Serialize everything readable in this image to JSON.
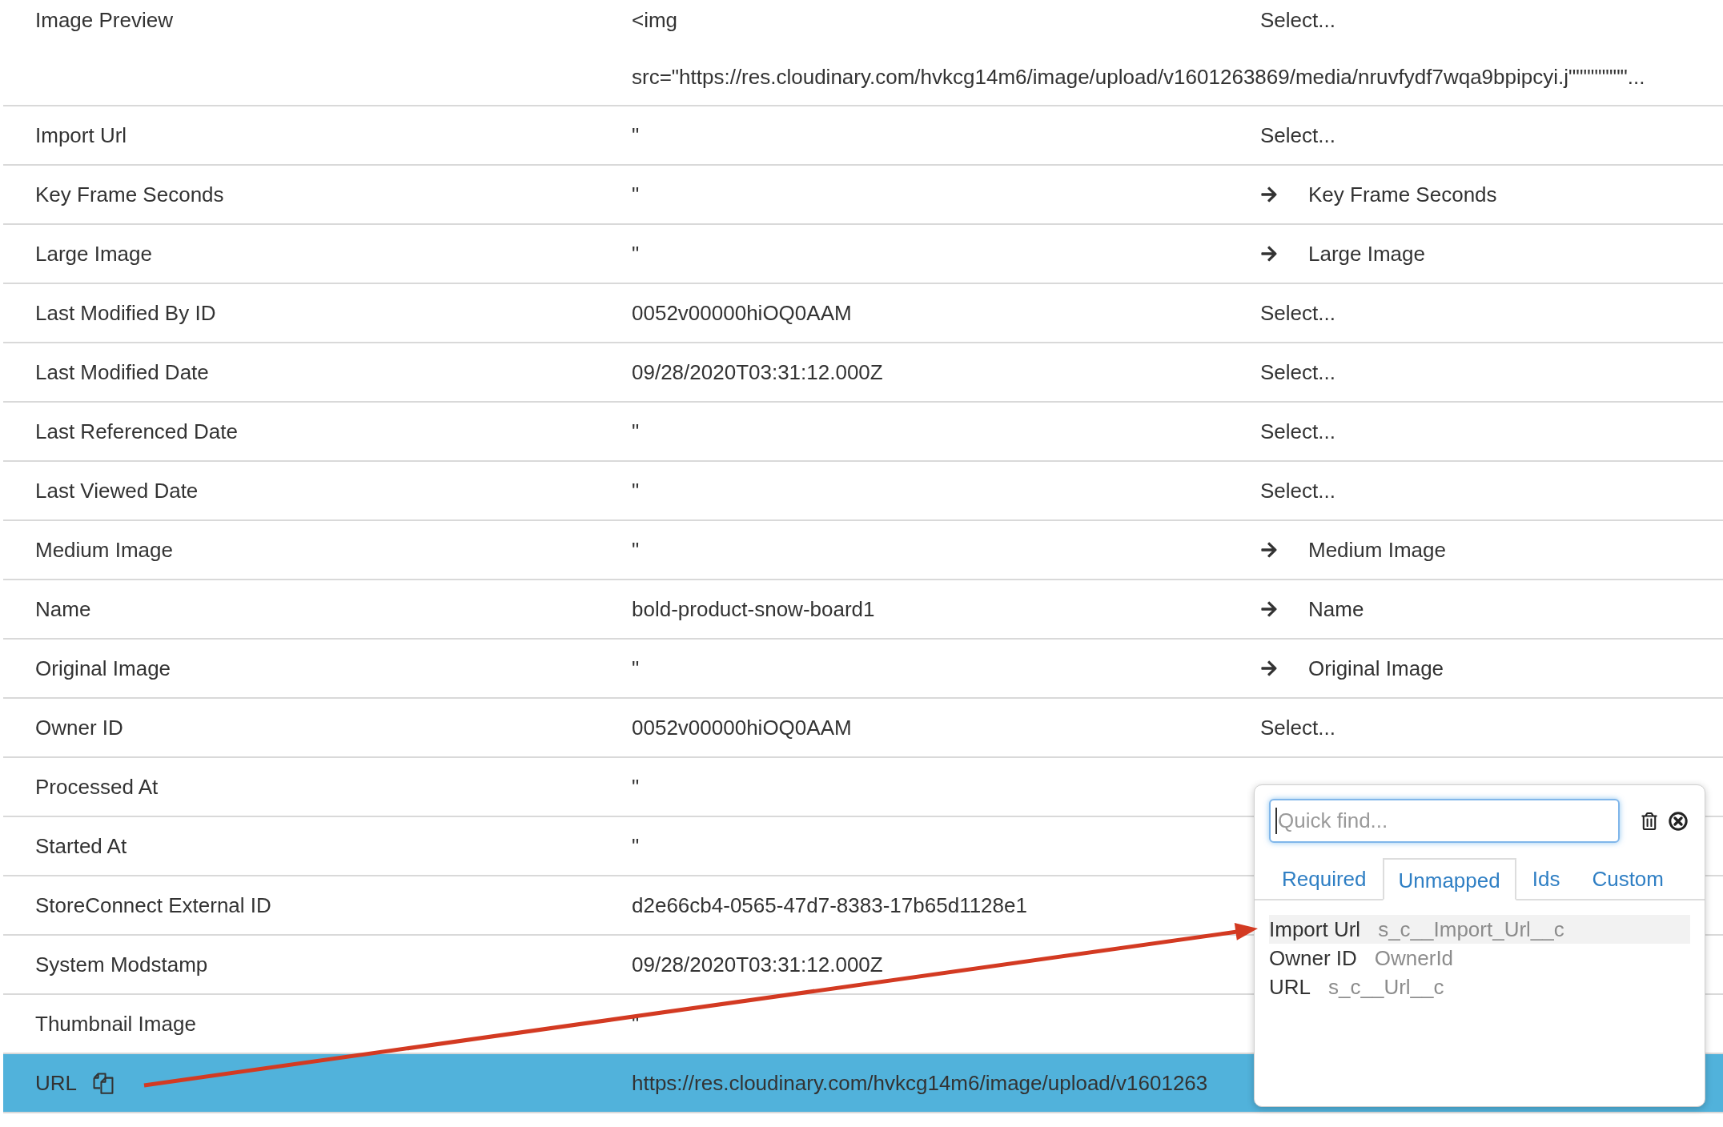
{
  "rows": [
    {
      "label": "Image Preview",
      "value": "<img",
      "value_overflow": "src=\"https://res.cloudinary.com/hvkcg14m6/image/upload/v1601263869/media/nruvfydf7wqa9bpipcyi.j\"\"\"\"\"\"\"\"...",
      "mapping": {
        "kind": "select",
        "text": "Select..."
      },
      "selected": false
    },
    {
      "label": "Import Url",
      "value": "\"",
      "mapping": {
        "kind": "select",
        "text": "Select..."
      },
      "selected": false
    },
    {
      "label": "Key Frame Seconds",
      "value": "\"",
      "mapping": {
        "kind": "mapped",
        "text": "Key Frame Seconds"
      },
      "selected": false
    },
    {
      "label": "Large Image",
      "value": "\"",
      "mapping": {
        "kind": "mapped",
        "text": "Large Image"
      },
      "selected": false
    },
    {
      "label": "Last Modified By ID",
      "value": "0052v00000hiOQ0AAM",
      "mapping": {
        "kind": "select",
        "text": "Select..."
      },
      "selected": false
    },
    {
      "label": "Last Modified Date",
      "value": "09/28/2020T03:31:12.000Z",
      "mapping": {
        "kind": "select",
        "text": "Select..."
      },
      "selected": false
    },
    {
      "label": "Last Referenced Date",
      "value": "\"",
      "mapping": {
        "kind": "select",
        "text": "Select..."
      },
      "selected": false
    },
    {
      "label": "Last Viewed Date",
      "value": "\"",
      "mapping": {
        "kind": "select",
        "text": "Select..."
      },
      "selected": false
    },
    {
      "label": "Medium Image",
      "value": "\"",
      "mapping": {
        "kind": "mapped",
        "text": "Medium Image"
      },
      "selected": false
    },
    {
      "label": "Name",
      "value": "bold-product-snow-board1",
      "mapping": {
        "kind": "mapped",
        "text": "Name"
      },
      "selected": false
    },
    {
      "label": "Original Image",
      "value": "\"",
      "mapping": {
        "kind": "mapped",
        "text": "Original Image"
      },
      "selected": false
    },
    {
      "label": "Owner ID",
      "value": "0052v00000hiOQ0AAM",
      "mapping": {
        "kind": "select",
        "text": "Select..."
      },
      "selected": false
    },
    {
      "label": "Processed At",
      "value": "\"",
      "selected": false
    },
    {
      "label": "Started At",
      "value": "\"",
      "selected": false
    },
    {
      "label": "StoreConnect External ID",
      "value": "d2e66cb4-0565-47d7-8383-17b65d1128e1",
      "selected": false
    },
    {
      "label": "System Modstamp",
      "value": "09/28/2020T03:31:12.000Z",
      "selected": false
    },
    {
      "label": "Thumbnail Image",
      "value": "\"",
      "selected": false
    },
    {
      "label": "URL",
      "value": "https://res.cloudinary.com/hvkcg14m6/image/upload/v1601263",
      "selected": true
    }
  ],
  "field_picker": {
    "search": {
      "placeholder": "Quick find...",
      "focused": true
    },
    "tabs": [
      {
        "label": "Required",
        "selected": false
      },
      {
        "label": "Unmapped",
        "selected": true
      },
      {
        "label": "Ids",
        "selected": false
      },
      {
        "label": "Custom",
        "selected": false
      }
    ],
    "items": [
      {
        "label": "Import Url",
        "api_name": "s_c__Import_Url__c",
        "selected": true
      },
      {
        "label": "Owner ID",
        "api_name": "OwnerId",
        "selected": false
      },
      {
        "label": "URL",
        "api_name": "s_c__Url__c",
        "selected": false
      }
    ]
  }
}
